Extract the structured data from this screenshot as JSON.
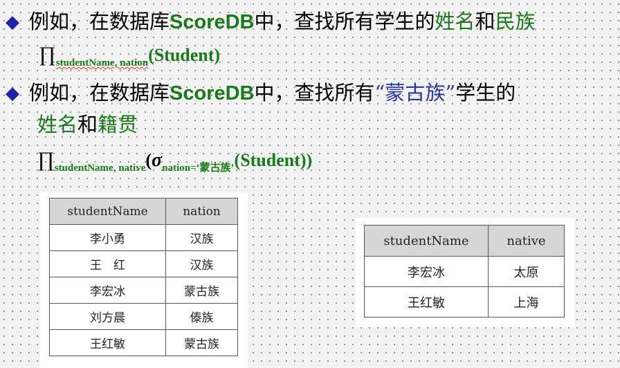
{
  "bullets": [
    {
      "marker": "◆",
      "parts": [
        "例如，在数据库",
        "ScoreDB",
        "中，查找所有学生的",
        "姓名",
        "和",
        "民族"
      ]
    },
    {
      "marker": "◆",
      "parts": [
        "例如，在数据库",
        "ScoreDB",
        "中，查找所有",
        "“蒙古族”",
        "学生的",
        "姓名",
        "和",
        "籍贯"
      ]
    }
  ],
  "formula1": {
    "pi": "∏",
    "subscript": "studentName, nation",
    "relation": "(Student)"
  },
  "formula2": {
    "pi": "∏",
    "subscript": "studentName, native",
    "open": "(",
    "sigma": "σ",
    "sigma_subscript": "nation=‘蒙古族’",
    "relation": "(Student))"
  },
  "table_nation": {
    "columns": [
      "studentName",
      "nation"
    ],
    "rows": [
      [
        "李小勇",
        "汉族"
      ],
      [
        "王　红",
        "汉族"
      ],
      [
        "李宏冰",
        "蒙古族"
      ],
      [
        "刘方晨",
        "傣族"
      ],
      [
        "王红敏",
        "蒙古族"
      ]
    ]
  },
  "table_native": {
    "columns": [
      "studentName",
      "native"
    ],
    "rows": [
      [
        "李宏冰",
        "太原"
      ],
      [
        "王红敏",
        "上海"
      ]
    ]
  },
  "colors": {
    "highlight_green": "#1a7a1a",
    "highlight_blue": "#2a36a8",
    "bullet": "#1e22a8"
  }
}
